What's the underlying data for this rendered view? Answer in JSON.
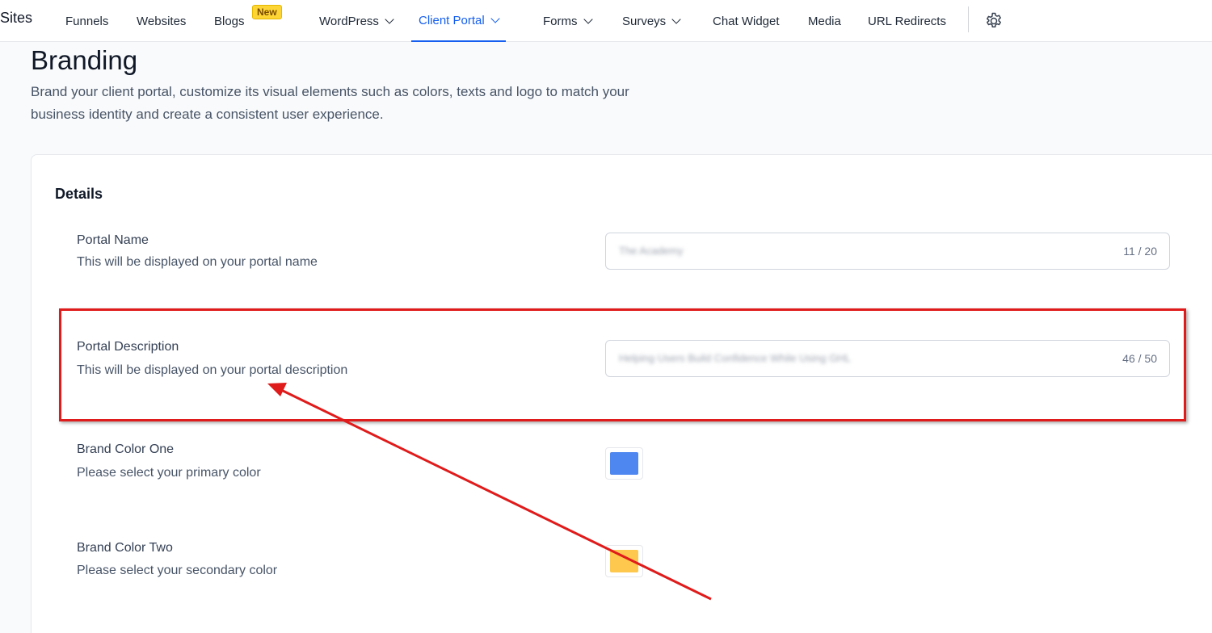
{
  "nav": {
    "brand": "Sites",
    "items": [
      {
        "label": "Funnels"
      },
      {
        "label": "Websites"
      },
      {
        "label": "Blogs"
      },
      {
        "label": "WordPress"
      },
      {
        "label": "Client Portal"
      },
      {
        "label": "Forms"
      },
      {
        "label": "Surveys"
      },
      {
        "label": "Chat Widget"
      },
      {
        "label": "Media"
      },
      {
        "label": "URL Redirects"
      }
    ],
    "new_badge": "New",
    "active_item": "Client Portal",
    "settings_icon": "gear-icon"
  },
  "page": {
    "title": "Branding",
    "subtitle_line1": "Brand your client portal, customize its visual elements such as colors, texts and logo to match your",
    "subtitle_line2": "business identity and create a consistent user experience."
  },
  "details": {
    "section_title": "Details",
    "portal_name": {
      "label": "Portal Name",
      "help": "This will be displayed on your portal name",
      "value": "The Academy",
      "counter": "11 / 20"
    },
    "portal_description": {
      "label": "Portal Description",
      "help": "This will be displayed on your portal description",
      "value": "Helping Users Build Confidence While Using GHL",
      "counter": "46 / 50"
    },
    "brand_color_one": {
      "label": "Brand Color One",
      "help": "Please select your primary color",
      "color": "#4f87f0"
    },
    "brand_color_two": {
      "label": "Brand Color Two",
      "help": "Please select your secondary color",
      "color": "#fdc84d"
    }
  },
  "colors": {
    "accent": "#155eef",
    "annotation": "#e01b1b"
  }
}
